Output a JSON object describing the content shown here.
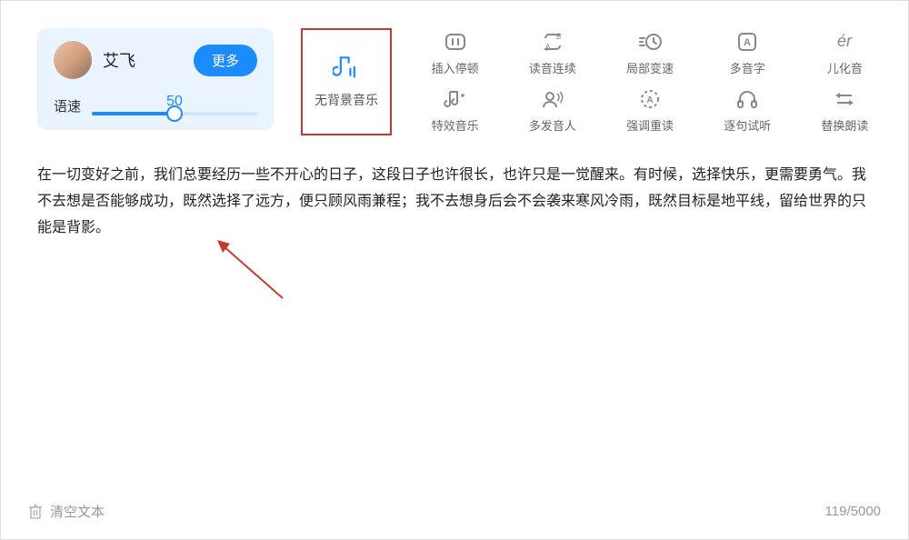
{
  "voice": {
    "name": "艾飞",
    "more": "更多",
    "speed_label": "语速",
    "speed_value": "50"
  },
  "bgm": {
    "label": "无背景音乐"
  },
  "tools": [
    {
      "label": "插入停顿",
      "name": "insert-pause"
    },
    {
      "label": "读音连续",
      "name": "continuous-read"
    },
    {
      "label": "局部变速",
      "name": "local-speed"
    },
    {
      "label": "多音字",
      "name": "polyphone"
    },
    {
      "label": "儿化音",
      "name": "erhua"
    },
    {
      "label": "特效音乐",
      "name": "effect-music"
    },
    {
      "label": "多发音人",
      "name": "multi-speaker"
    },
    {
      "label": "强调重读",
      "name": "emphasis"
    },
    {
      "label": "逐句试听",
      "name": "sentence-preview"
    },
    {
      "label": "替换朗读",
      "name": "replace-read"
    }
  ],
  "content": "在一切变好之前，我们总要经历一些不开心的日子，这段日子也许很长，也许只是一觉醒来。有时候，选择快乐，更需要勇气。我不去想是否能够成功，既然选择了远方，便只顾风雨兼程；我不去想身后会不会袭来寒风冷雨，既然目标是地平线，留给世界的只能是背影。",
  "footer": {
    "clear": "清空文本",
    "counter": "119/5000"
  }
}
